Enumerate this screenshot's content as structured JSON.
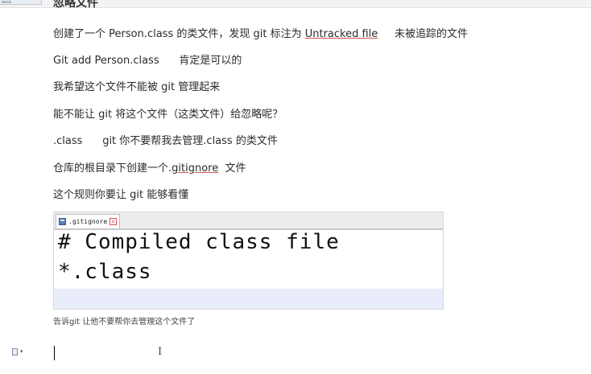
{
  "top_tab_label": "ooce",
  "heading_fragment": "忽略文件",
  "notes": [
    {
      "text_before": "创建了一个 Person.class 的类文件，发现 git 标注为 ",
      "underlined": "Untracked file",
      "text_after": "     未被追踪的文件"
    },
    {
      "text": "Git add Person.class      肯定是可以的"
    },
    {
      "text": "我希望这个文件不能被 git 管理起来"
    },
    {
      "text": "能不能让 git 将这个文件（这类文件）给忽略呢？"
    },
    {
      "text": ".class      git 你不要帮我去管理.class 的类文件"
    },
    {
      "text_before": "仓库的根目录下创建一个.",
      "underlined": "gitignore",
      "text_after": "  文件"
    },
    {
      "text": "这个规则你要让 git 能够看懂"
    }
  ],
  "editor": {
    "tab_label": ".gitignore",
    "close_glyph": "✕",
    "lines": [
      "# Compiled class file",
      "*.class"
    ]
  },
  "caption": "告诉git 让他不要帮你去管理这个文件了",
  "bottom": {
    "page_dropdown_glyph": "▾",
    "ibeam_glyph": "I"
  },
  "colors": {
    "current_line_highlight": "#e8ecfb",
    "underline": "#d9534f"
  }
}
